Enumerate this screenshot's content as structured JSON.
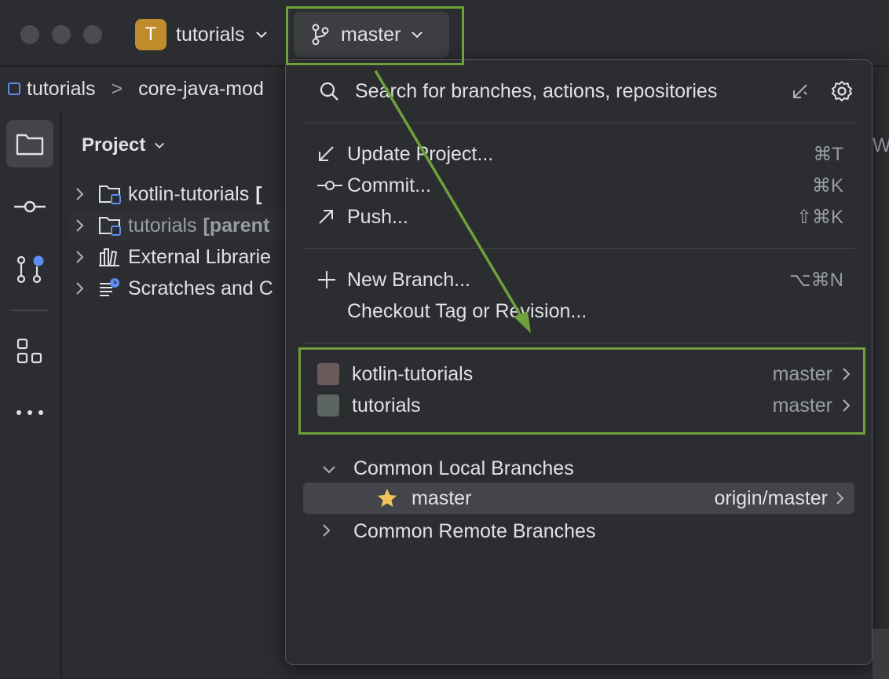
{
  "titlebar": {
    "project_initial": "T",
    "project_name": "tutorials",
    "branch": "master"
  },
  "breadcrumb": [
    "tutorials",
    ">",
    "core-java-mod"
  ],
  "project_panel": {
    "title": "Project",
    "tree": [
      {
        "name": "kotlin-tutorials",
        "suffix": "[",
        "icon": "module-folder-icon"
      },
      {
        "name": "tutorials",
        "suffix": "[parent",
        "icon": "module-folder-icon"
      },
      {
        "name": "External Librarie",
        "suffix": "",
        "icon": "library-icon"
      },
      {
        "name": "Scratches and C",
        "suffix": "",
        "icon": "scratches-icon"
      }
    ],
    "edge_text": "W"
  },
  "popup": {
    "search_placeholder": "Search for branches, actions, repositories",
    "actions": [
      {
        "label": "Update Project...",
        "shortcut": "⌘T",
        "icon": "update-icon"
      },
      {
        "label": "Commit...",
        "shortcut": "⌘K",
        "icon": "commit-icon"
      },
      {
        "label": "Push...",
        "shortcut": "⇧⌘K",
        "icon": "push-icon"
      }
    ],
    "branch_actions": [
      {
        "label": "New Branch...",
        "shortcut": "⌥⌘N",
        "icon": "plus-icon"
      },
      {
        "label": "Checkout Tag or Revision...",
        "shortcut": "",
        "icon": ""
      }
    ],
    "repositories": [
      {
        "name": "kotlin-tutorials",
        "branch": "master",
        "color": "#6b5c5c"
      },
      {
        "name": "tutorials",
        "branch": "master",
        "color": "#5c6560"
      }
    ],
    "common_local": {
      "label": "Common Local Branches",
      "branches": [
        {
          "name": "master",
          "tracking": "origin/master"
        }
      ]
    },
    "common_remote": {
      "label": "Common Remote Branches"
    }
  },
  "colors": {
    "highlight": "#6ea03c",
    "accent_blue": "#5b8ef0",
    "star": "#f2c55c",
    "avatar": "#c08b2a"
  }
}
